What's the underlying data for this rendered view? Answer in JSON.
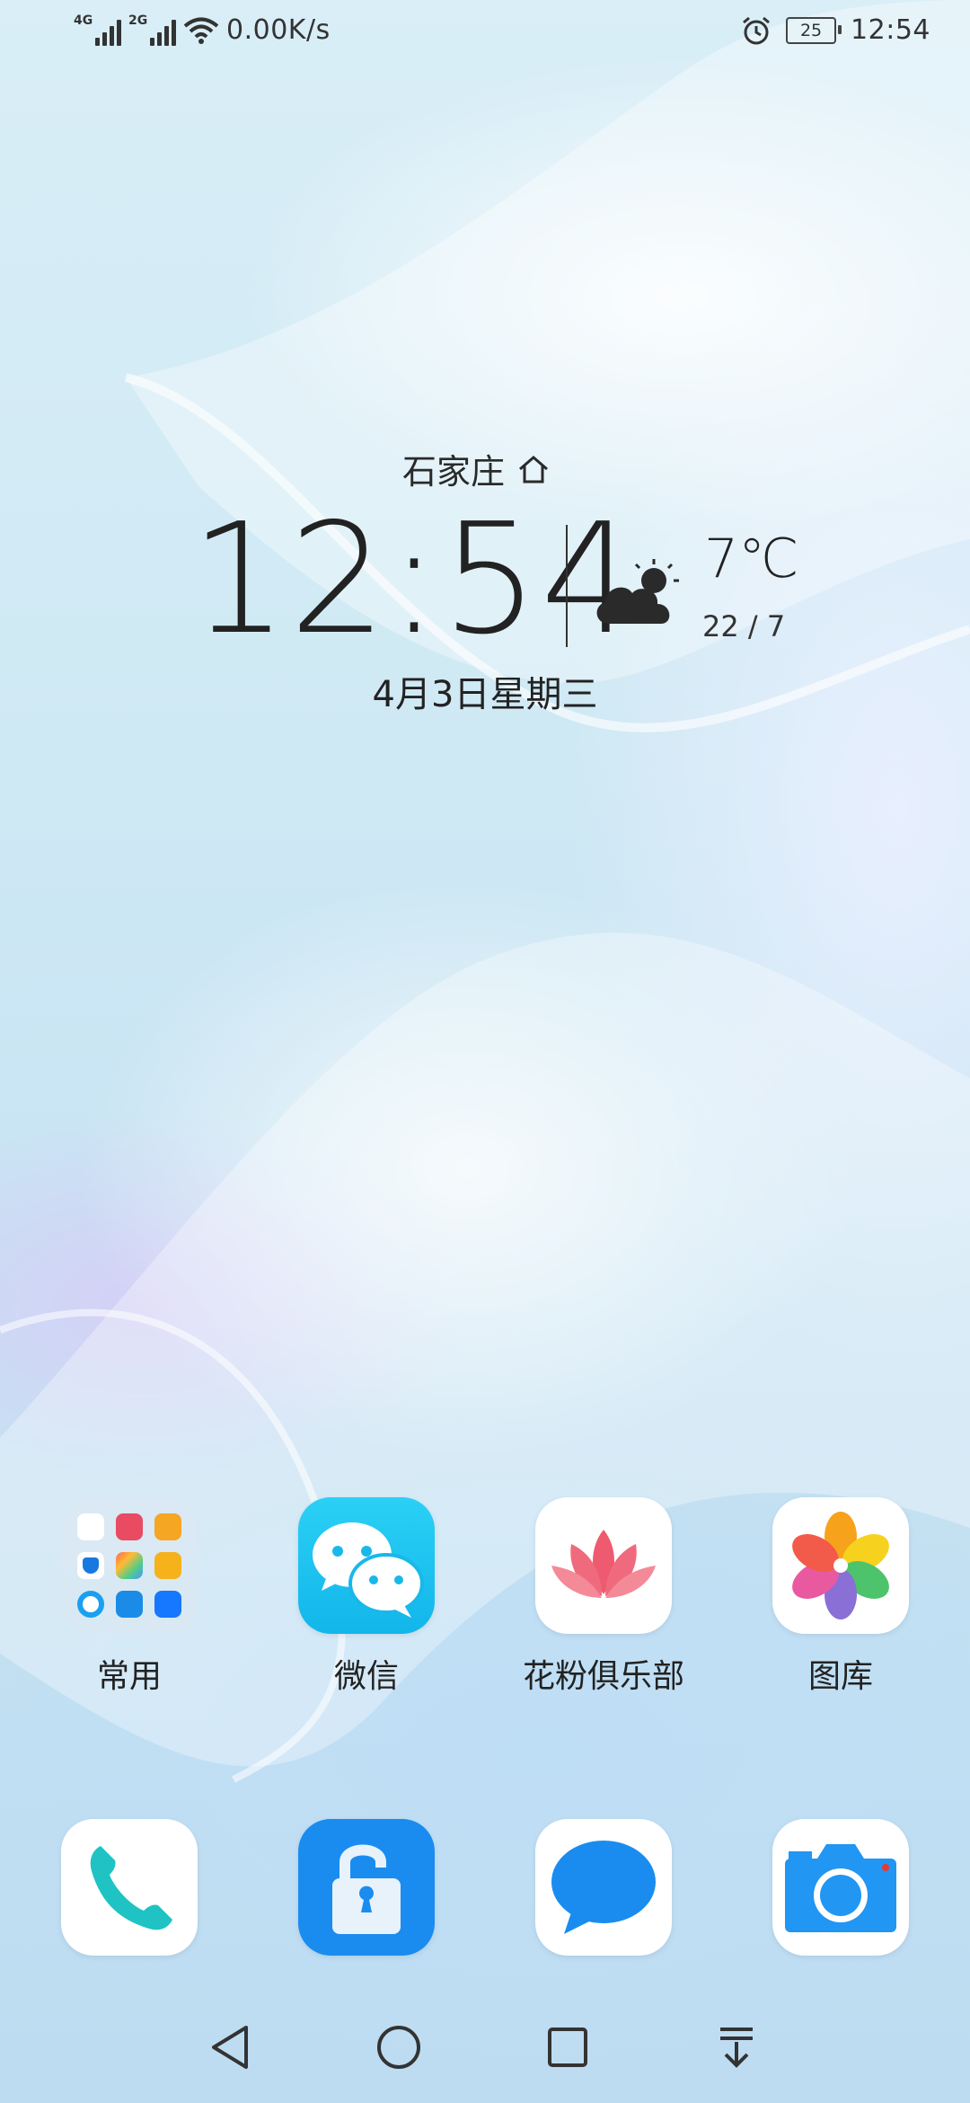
{
  "status_bar": {
    "network_1": "4G",
    "network_2": "2G",
    "speed": "0.00K/s",
    "battery": "25",
    "time": "12:54",
    "icons": [
      "signal-icon",
      "wifi-icon",
      "alarm-icon",
      "battery-icon"
    ]
  },
  "widget": {
    "city": "石家庄",
    "time": "12:54",
    "temperature": "7℃",
    "range": "22 / 7",
    "date": "4月3日星期三",
    "weather_icon": "partly-cloudy-icon"
  },
  "apps": [
    {
      "label": "常用",
      "icon": "folder-icon"
    },
    {
      "label": "微信",
      "icon": "wechat-icon"
    },
    {
      "label": "花粉俱乐部",
      "icon": "lotus-icon"
    },
    {
      "label": "图库",
      "icon": "gallery-icon"
    }
  ],
  "dock": [
    {
      "icon": "phone-icon"
    },
    {
      "icon": "lock-icon"
    },
    {
      "icon": "messages-icon"
    },
    {
      "icon": "camera-icon"
    }
  ],
  "nav": [
    "back-icon",
    "home-icon",
    "recents-icon",
    "notification-pull-icon"
  ],
  "colors": {
    "wechat": "#1ec4f0",
    "lock": "#1a8cf0",
    "camera": "#2196f3",
    "messages": "#1a8cf0"
  }
}
